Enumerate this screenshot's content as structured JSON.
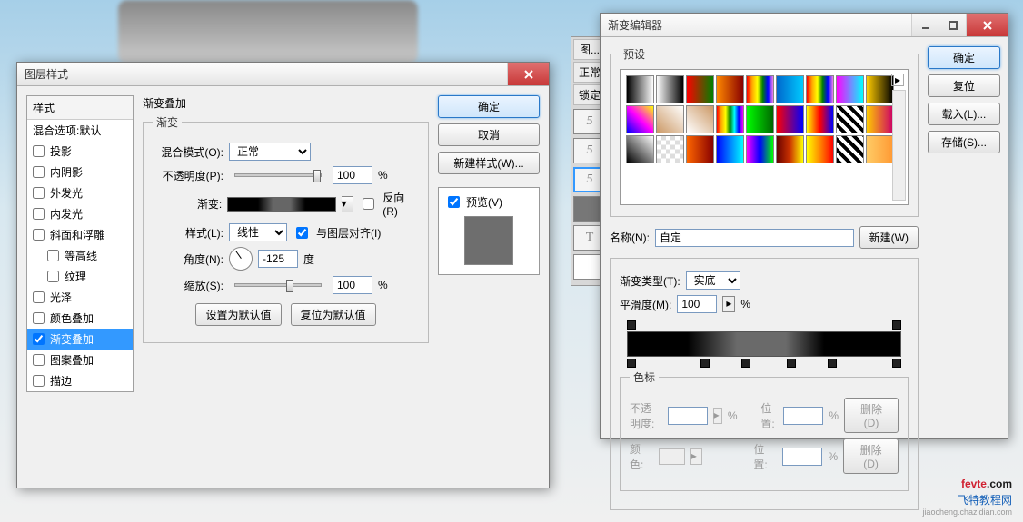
{
  "dlg1": {
    "title": "图层样式",
    "styles_header": "样式",
    "styles_default": "混合选项:默认",
    "items": [
      "投影",
      "内阴影",
      "外发光",
      "内发光",
      "斜面和浮雕",
      "等高线",
      "纹理",
      "光泽",
      "颜色叠加",
      "渐变叠加",
      "图案叠加",
      "描边"
    ],
    "section_title": "渐变叠加",
    "subsection": "渐变",
    "blend_mode_label": "混合模式(O):",
    "blend_mode_value": "正常",
    "opacity_label": "不透明度(P):",
    "opacity_value": "100",
    "percent": "%",
    "gradient_label": "渐变:",
    "reverse_label": "反向(R)",
    "style_label": "样式(L):",
    "style_value": "线性",
    "align_label": "与图层对齐(I)",
    "angle_label": "角度(N):",
    "angle_value": "-125",
    "angle_unit": "度",
    "scale_label": "缩放(S):",
    "scale_value": "100",
    "set_default": "设置为默认值",
    "reset_default": "复位为默认值",
    "ok": "确定",
    "cancel": "取消",
    "new_style": "新建样式(W)...",
    "preview": "预览(V)"
  },
  "dlg2": {
    "title": "渐变编辑器",
    "presets": "预设",
    "ok": "确定",
    "reset": "复位",
    "load": "载入(L)...",
    "save": "存储(S)...",
    "name_label": "名称(N):",
    "name_value": "自定",
    "new_btn": "新建(W)",
    "grad_type_label": "渐变类型(T):",
    "grad_type_value": "实底",
    "smoothness_label": "平滑度(M):",
    "smoothness_value": "100",
    "percent": "%",
    "stops_title": "色标",
    "stop_opacity": "不透明度:",
    "stop_position": "位置:",
    "stop_color": "颜色:",
    "delete": "删除(D)"
  },
  "layers": {
    "tab": "图...",
    "normal": "正常",
    "lock": "锁定"
  },
  "watermark": {
    "brand1": "fevte",
    "brand2": ".com",
    "line2": "飞特教程网",
    "line3": "jiaocheng.chazidian.com"
  }
}
